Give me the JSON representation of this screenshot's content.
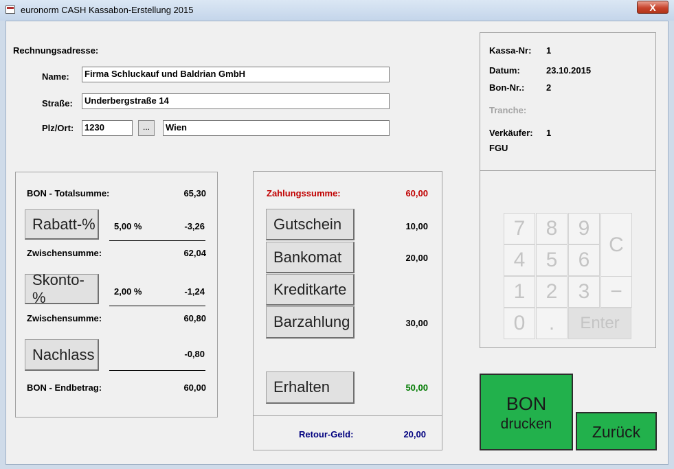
{
  "window": {
    "title": "euronorm CASH Kassabon-Erstellung 2015",
    "close_label": "X"
  },
  "address": {
    "heading": "Rechnungsadresse:",
    "name_label": "Name:",
    "name_value": "Firma Schluckauf und Baldrian GmbH",
    "street_label": "Straße:",
    "street_value": "Underbergstraße 14",
    "city_label": "Plz/Ort:",
    "zip_value": "1230",
    "lookup_label": "...",
    "city_value": "Wien"
  },
  "info": {
    "kassa_label": "Kassa-Nr:",
    "kassa_value": "1",
    "datum_label": "Datum:",
    "datum_value": "23.10.2015",
    "bon_label": "Bon-Nr.:",
    "bon_value": "2",
    "tranche_label": "Tranche:",
    "verkaeufer_label": "Verkäufer:",
    "verkaeufer_value": "1",
    "verkaeufer_name": "FGU"
  },
  "totals": {
    "total_label": "BON - Totalsumme:",
    "total_value": "65,30",
    "rabatt_button": "Rabatt-%",
    "rabatt_pct": "5,00 %",
    "rabatt_value": "-3,26",
    "zwischen1_label": "Zwischensumme:",
    "zwischen1_value": "62,04",
    "skonto_button": "Skonto-%",
    "skonto_pct": "2,00 %",
    "skonto_value": "-1,24",
    "zwischen2_label": "Zwischensumme:",
    "zwischen2_value": "60,80",
    "nachlass_button": "Nachlass",
    "nachlass_value": "-0,80",
    "end_label": "BON - Endbetrag:",
    "end_value": "60,00"
  },
  "payment": {
    "sum_label": "Zahlungssumme:",
    "sum_value": "60,00",
    "gutschein_button": "Gutschein",
    "gutschein_value": "10,00",
    "bankomat_button": "Bankomat",
    "bankomat_value": "20,00",
    "kreditkarte_button": "Kreditkarte",
    "barzahlung_button": "Barzahlung",
    "barzahlung_value": "30,00",
    "erhalten_button": "Erhalten",
    "erhalten_value": "50,00",
    "retour_label": "Retour-Geld:",
    "retour_value": "20,00"
  },
  "keypad": {
    "k7": "7",
    "k8": "8",
    "k9": "9",
    "kc": "C",
    "k4": "4",
    "k5": "5",
    "k6": "6",
    "k1": "1",
    "k2": "2",
    "k3": "3",
    "kminus": "−",
    "k0": "0",
    "kdot": ".",
    "kenter": "Enter"
  },
  "actions": {
    "bon_line1": "BON",
    "bon_line2": "drucken",
    "zurueck": "Zurück"
  },
  "colors": {
    "sum_red": "#c00000",
    "received_green": "#007a00",
    "retour_blue": "#00007f",
    "action_green": "#22b14c"
  }
}
